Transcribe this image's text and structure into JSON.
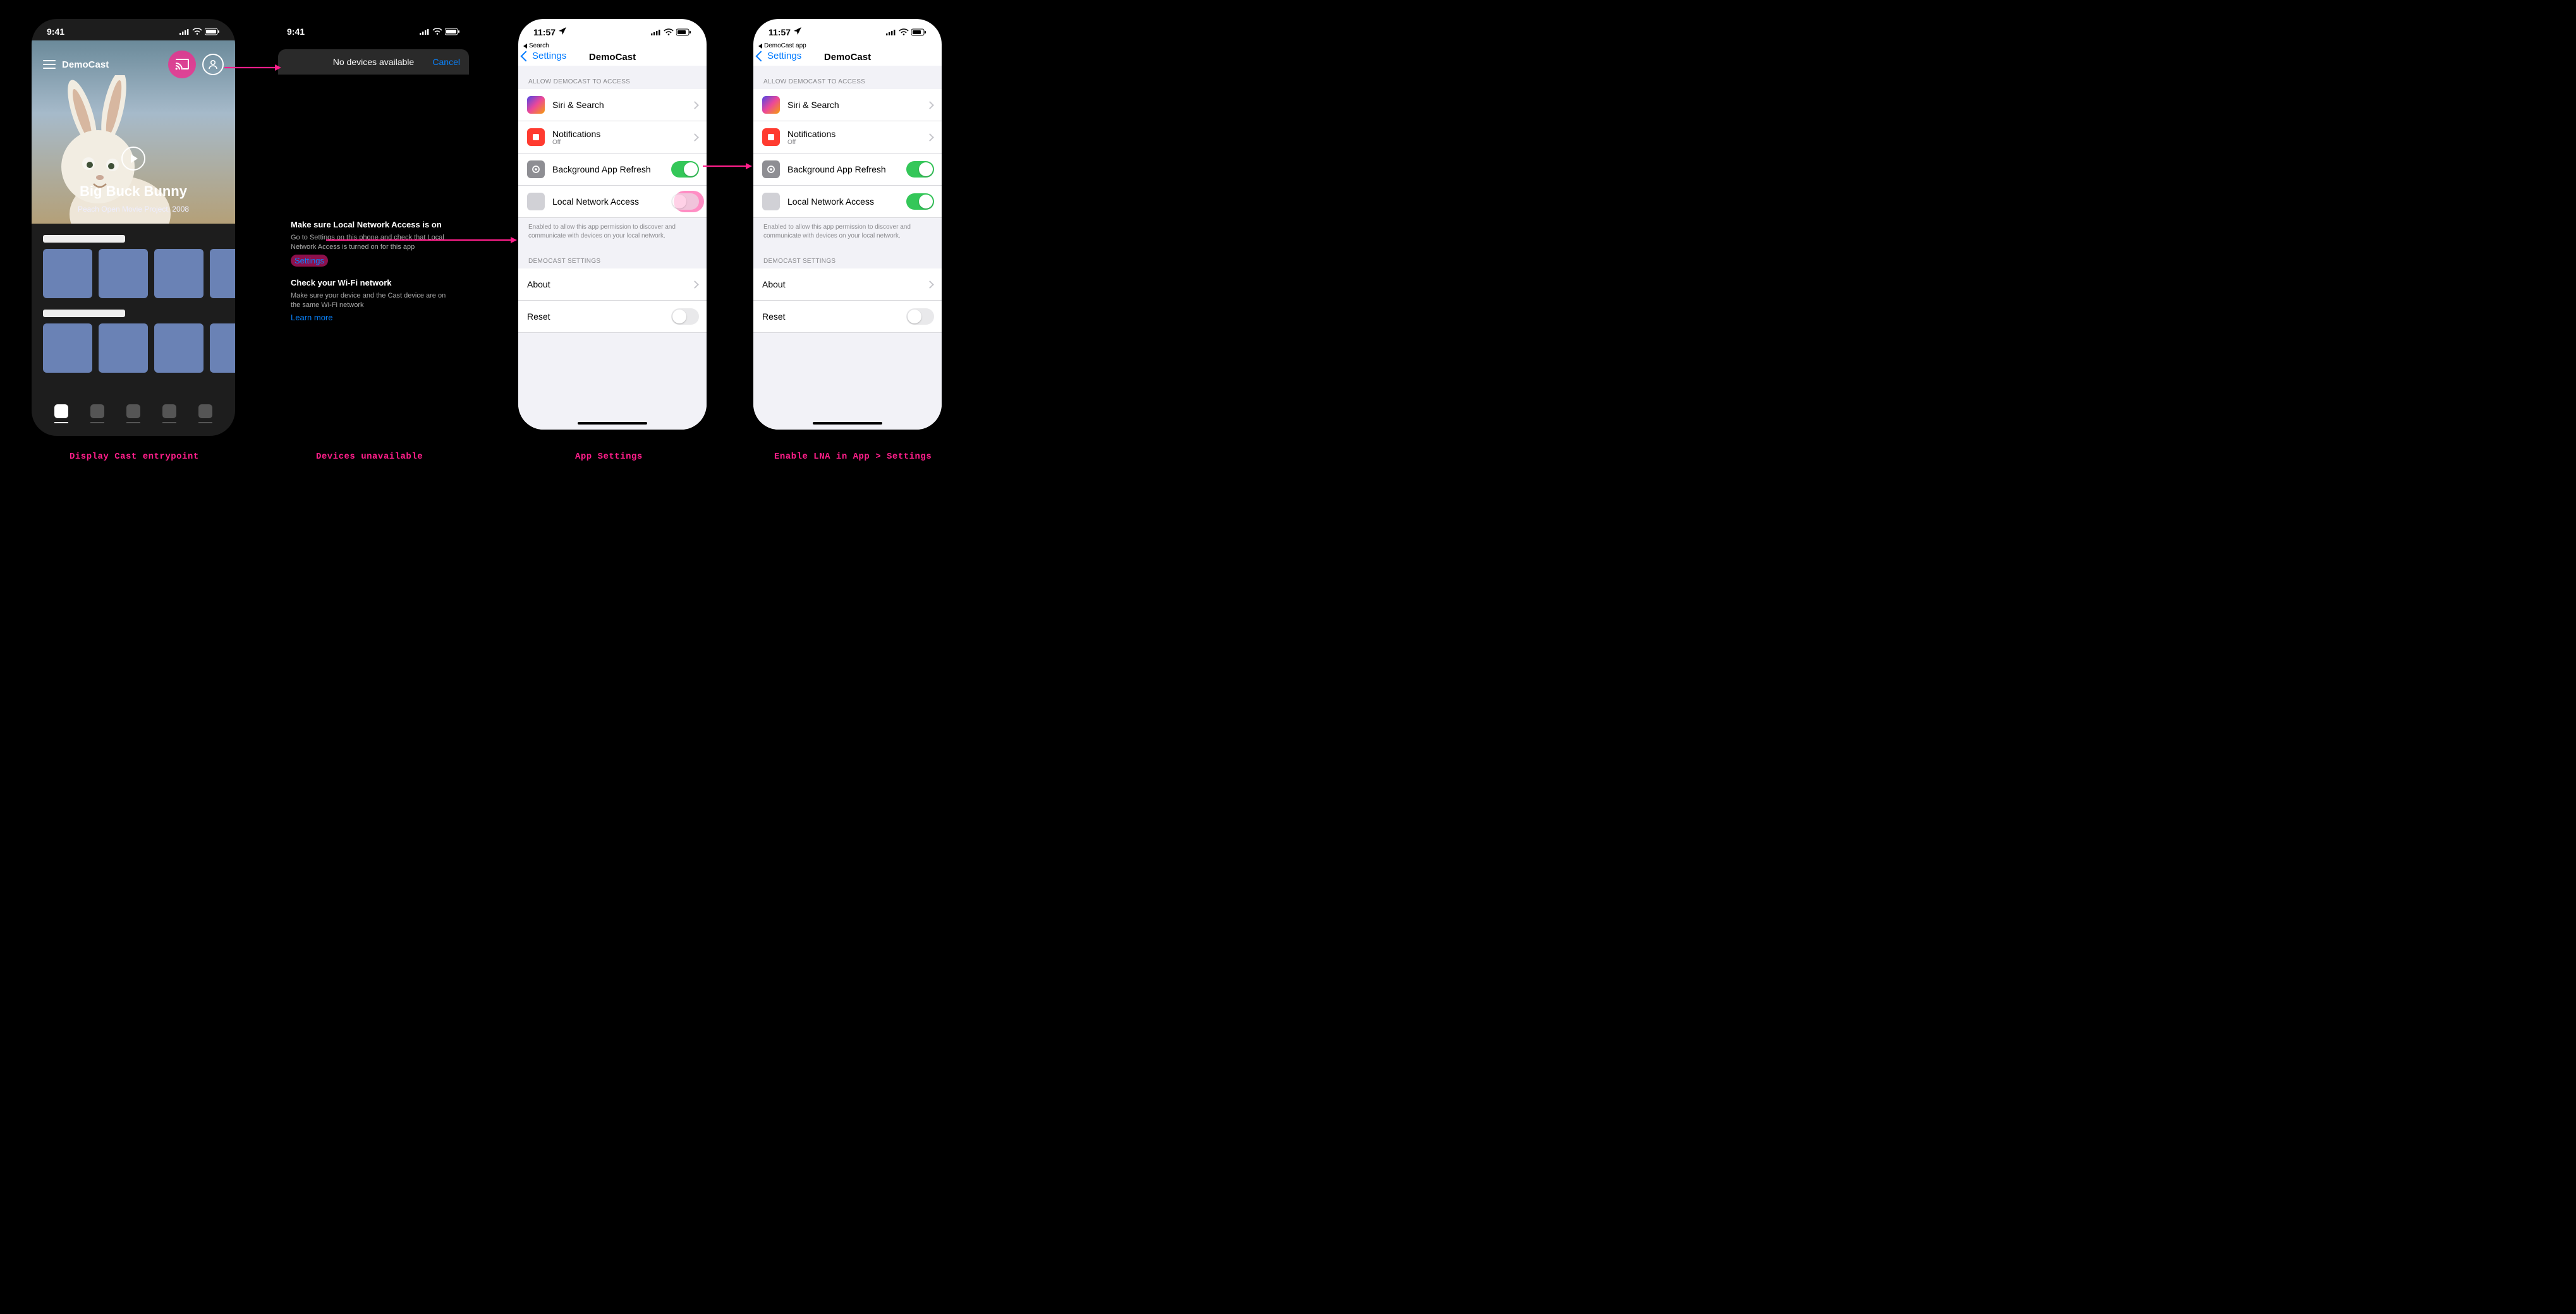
{
  "captions": {
    "c1": "Display Cast entrypoint",
    "c2": "Devices unavailable",
    "c3": "App Settings",
    "c4": "Enable LNA in App > Settings"
  },
  "phone1": {
    "time": "9:41",
    "appName": "DemoCast",
    "heroTitle": "Big Buck Bunny",
    "heroSubtitle": "Peach Open Movie Project, 2008"
  },
  "phone2": {
    "time": "9:41",
    "sheetTitle": "No devices available",
    "cancel": "Cancel",
    "h1": "Make sure Local Network Access is on",
    "p1": "Go to Settings on this phone and check that Local Network Access is turned on for this app",
    "settingsLink": "Settings",
    "h2": "Check your Wi-Fi network",
    "p2": "Make sure your device and the Cast device are on the same Wi-Fi network",
    "learnMore": "Learn more"
  },
  "settingsCommon": {
    "back": "Settings",
    "title": "DemoCast",
    "grpAccess": "ALLOW DEMOCAST TO ACCESS",
    "siri": "Siri & Search",
    "notif": "Notifications",
    "notifSub": "Off",
    "bgar": "Background App Refresh",
    "lna": "Local Network Access",
    "lnaFooter": "Enabled to allow this app permission to discover and communicate with devices on your local network.",
    "grpAppSettings": "DEMOCAST SETTINGS",
    "about": "About",
    "reset": "Reset"
  },
  "phone3": {
    "time": "11:57",
    "breadcrumb": "Search",
    "lnaOn": false
  },
  "phone4": {
    "time": "11:57",
    "breadcrumb": "DemoCast app",
    "lnaOn": true
  }
}
